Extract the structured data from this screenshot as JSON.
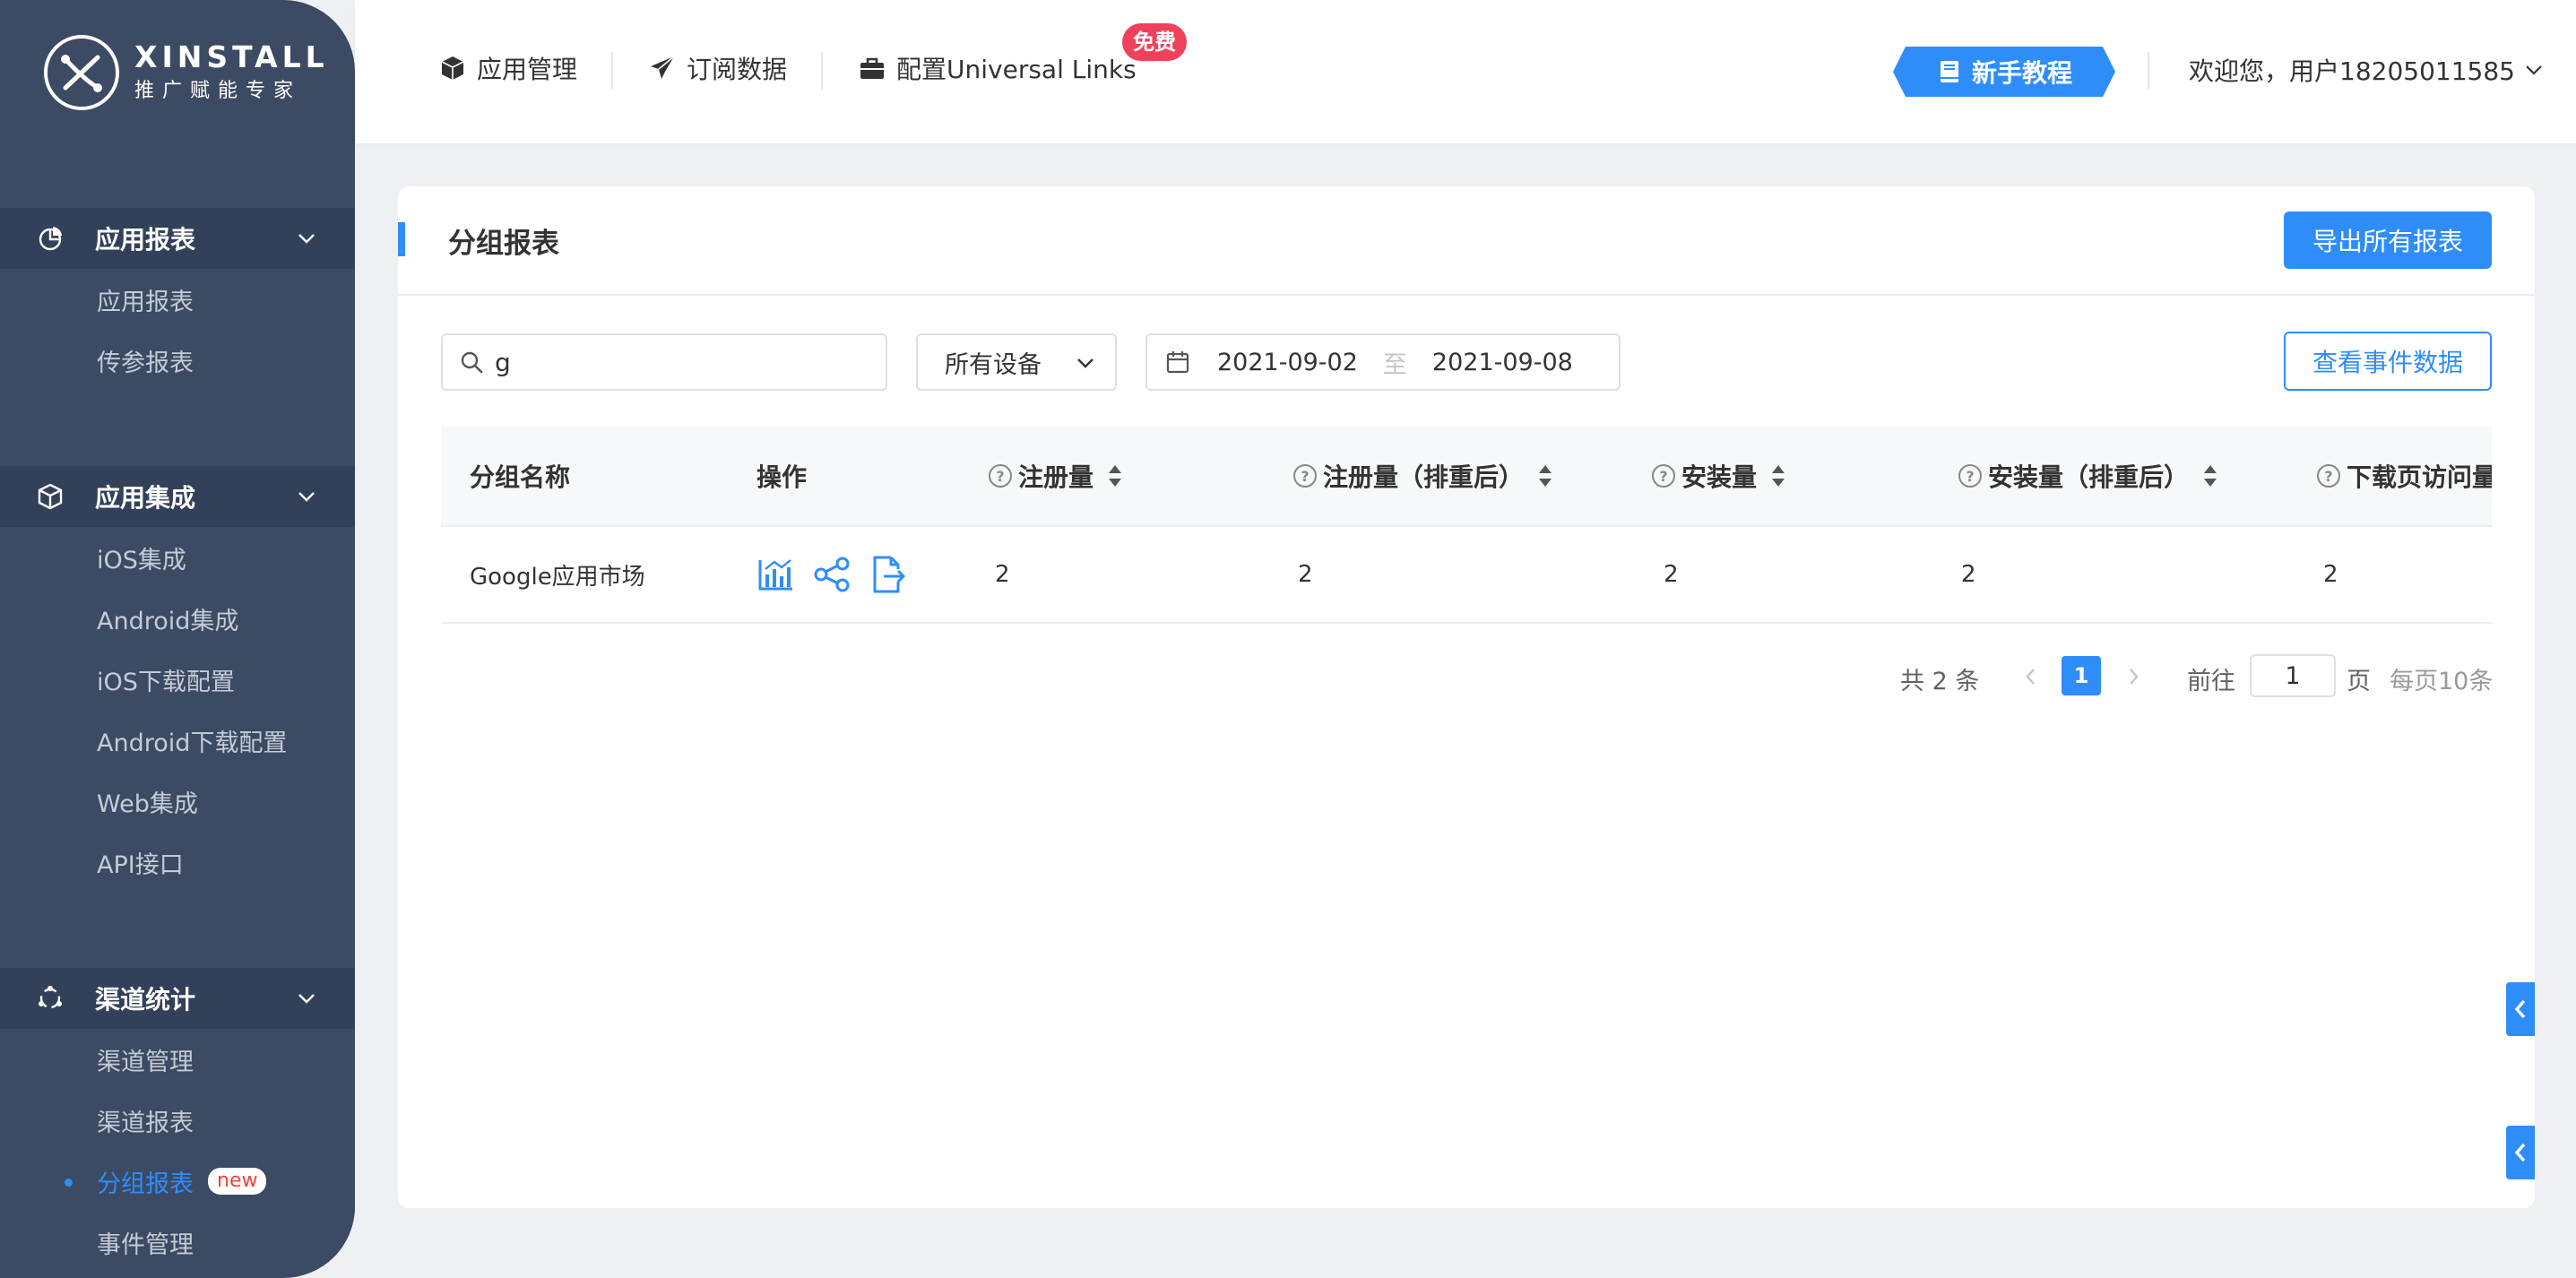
{
  "brand": {
    "title": "XINSTALL",
    "subtitle": "推广赋能专家"
  },
  "sidebar": {
    "groups": [
      {
        "label": "应用报表",
        "icon": "pie-chart-icon",
        "items": [
          {
            "label": "应用报表"
          },
          {
            "label": "传参报表"
          }
        ]
      },
      {
        "label": "应用集成",
        "icon": "cube-icon",
        "items": [
          {
            "label": "iOS集成"
          },
          {
            "label": "Android集成"
          },
          {
            "label": "iOS下载配置"
          },
          {
            "label": "Android下载配置"
          },
          {
            "label": "Web集成"
          },
          {
            "label": "API接口"
          }
        ]
      },
      {
        "label": "渠道统计",
        "icon": "network-icon",
        "items": [
          {
            "label": "渠道管理"
          },
          {
            "label": "渠道报表"
          },
          {
            "label": "分组报表",
            "active": true,
            "badge": "new"
          },
          {
            "label": "事件管理"
          }
        ]
      }
    ]
  },
  "topnav": {
    "items": [
      {
        "label": "应用管理",
        "icon": "cube-icon"
      },
      {
        "label": "订阅数据",
        "icon": "paper-plane-icon"
      },
      {
        "label": "配置Universal Links",
        "icon": "briefcase-icon"
      }
    ],
    "free_badge": "免费",
    "tutorial": "新手教程",
    "user": "欢迎您，用户18205011585"
  },
  "page": {
    "title": "分组报表",
    "export_label": "导出所有报表",
    "event_label": "查看事件数据",
    "search_value": "g",
    "device_select": "所有设备",
    "date_start": "2021-09-02",
    "date_sep": "至",
    "date_end": "2021-09-08"
  },
  "table": {
    "columns": [
      "分组名称",
      "操作",
      "注册量",
      "注册量（排重后）",
      "安装量",
      "安装量（排重后）",
      "下载页访问量"
    ],
    "rows": [
      {
        "name": "Google应用市场",
        "values": [
          "2",
          "2",
          "2",
          "2",
          "2"
        ]
      }
    ]
  },
  "pagination": {
    "total": "共 2 条",
    "current": "1",
    "goto_label": "前往",
    "goto_value": "1",
    "page_label": "页",
    "page_size": "每页10条"
  },
  "colors": {
    "accent": "#2f8dfa",
    "sidebar": "#3c4a63",
    "badge": "#f1415a"
  }
}
